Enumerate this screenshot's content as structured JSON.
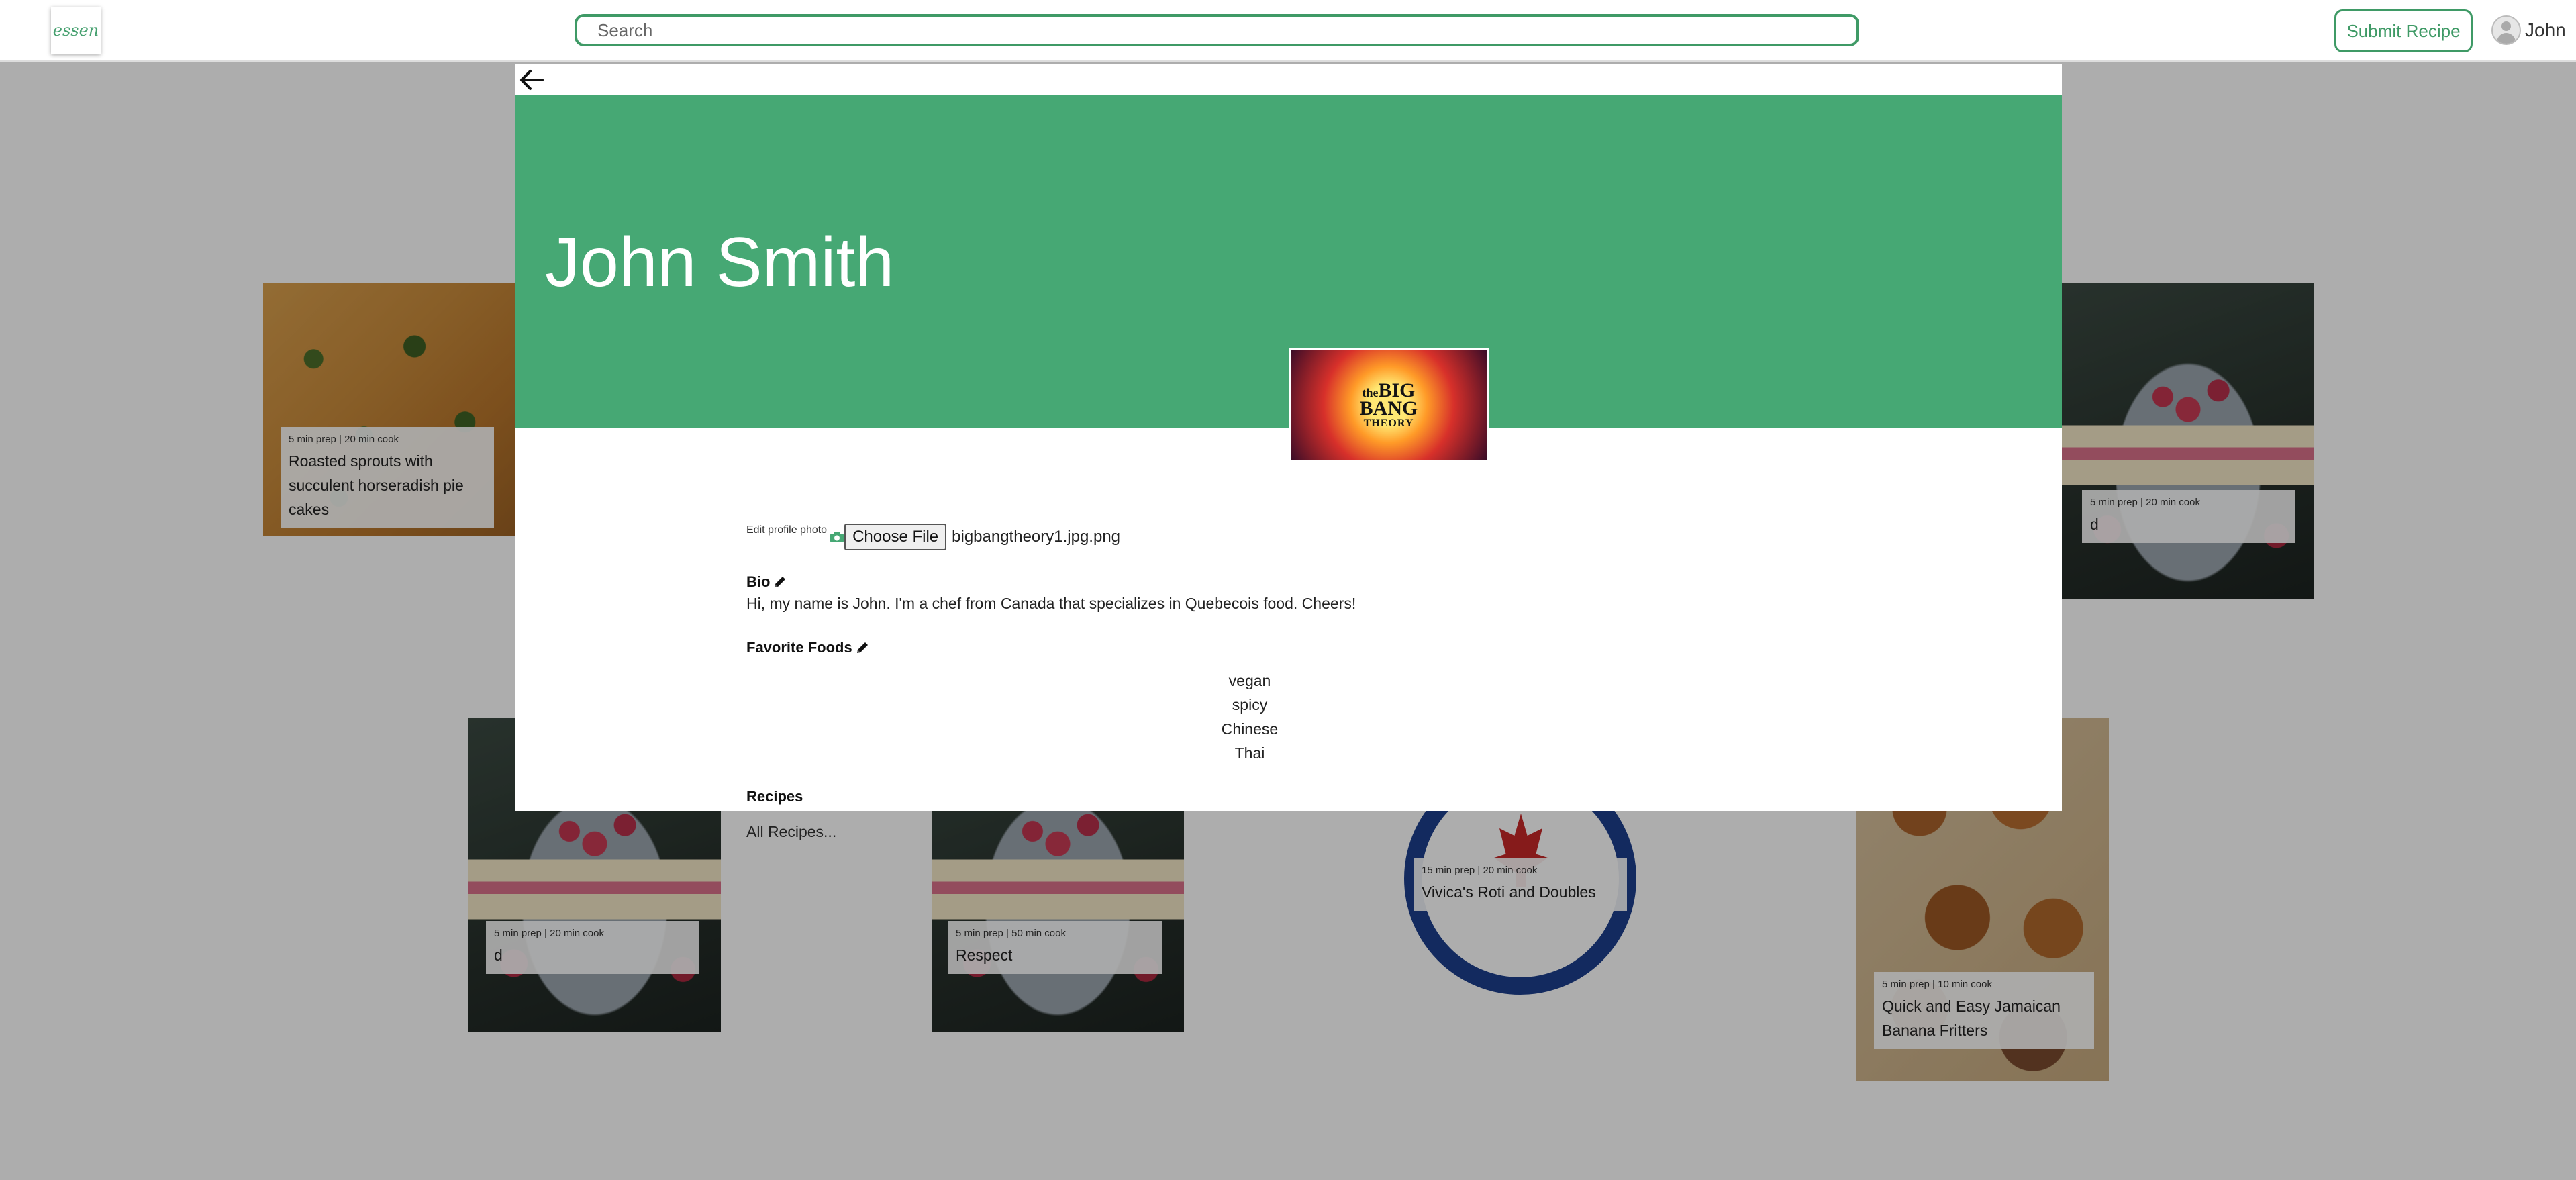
{
  "header": {
    "logo_text": "essen",
    "search_placeholder": "Search",
    "submit_label": "Submit Recipe",
    "user_name": "John"
  },
  "cards": [
    {
      "meta": "5 min prep | 20 min cook",
      "title": "Roasted sprouts with succulent horseradish pie cakes",
      "image": "roasted-sprouts-photo"
    },
    {
      "meta": "5 min prep | 20 min cook",
      "title": "d",
      "image": "raspberry-cake-photo"
    },
    {
      "meta": "5 min prep | 20 min cook",
      "title": "d",
      "image": "raspberry-cake-photo"
    },
    {
      "meta": "5 min prep | 50 min cook",
      "title": "Respect",
      "image": "raspberry-cake-photo"
    },
    {
      "meta": "15 min prep | 20 min cook",
      "title": "Vivica's Roti and Doubles",
      "image": "canadian-logo-image"
    },
    {
      "meta": "5 min prep | 10 min cook",
      "title": "Quick and Easy Jamaican Banana Fritters",
      "image": "banana-fritters-photo"
    }
  ],
  "profile": {
    "name": "John Smith",
    "photo_logo": [
      "the",
      "BIG",
      "BANG",
      "THEORY"
    ],
    "edit_photo_label": "Edit profile photo",
    "choose_file_label": "Choose File",
    "file_name": "bigbangtheory1.jpg.png",
    "bio_heading": "Bio",
    "bio_text": "Hi, my name is John. I'm a chef from Canada that specializes in Quebecois food. Cheers!",
    "favorite_foods_heading": "Favorite Foods",
    "favorite_foods": [
      "vegan",
      "spicy",
      "Chinese",
      "Thai"
    ],
    "recipes_heading": "Recipes",
    "all_recipes_link": "All Recipes..."
  },
  "colors": {
    "brand_green": "#46a874",
    "outline_green": "#3f9a66"
  }
}
